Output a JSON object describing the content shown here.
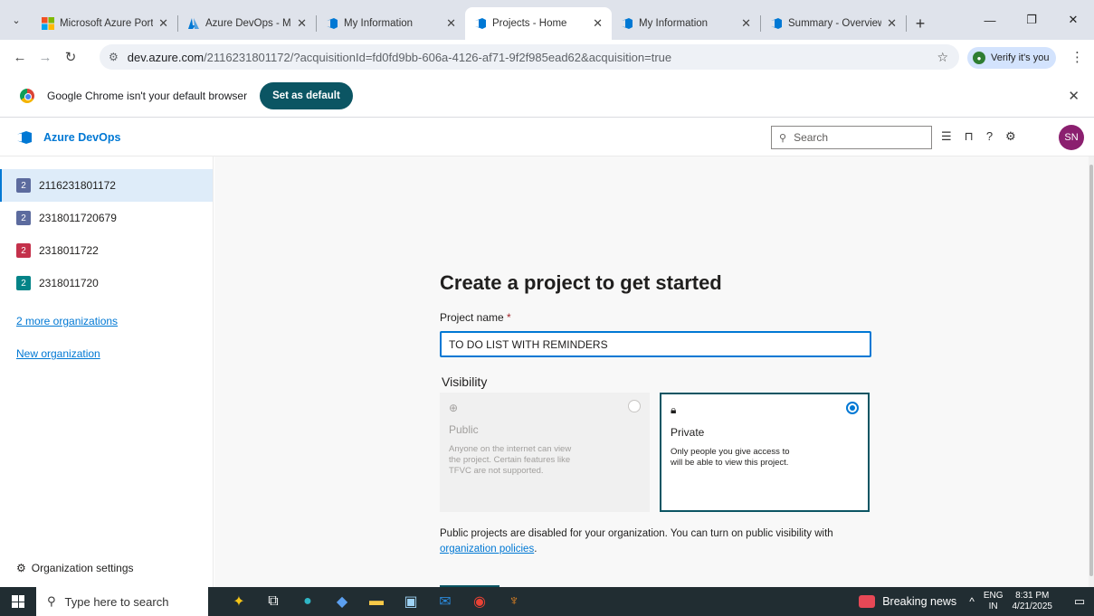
{
  "browser": {
    "tabs": [
      {
        "title": "Microsoft Azure Porta",
        "active": false,
        "favicon_color": "#f25022"
      },
      {
        "title": "Azure DevOps - Micr",
        "active": false,
        "favicon_color": "#0078d4"
      },
      {
        "title": "My Information",
        "active": false,
        "favicon_color": "#0078d4"
      },
      {
        "title": "Projects - Home",
        "active": true,
        "favicon_color": "#0078d4"
      },
      {
        "title": "My Information",
        "active": false,
        "favicon_color": "#0078d4"
      },
      {
        "title": "Summary - Overview",
        "active": false,
        "favicon_color": "#0078d4"
      }
    ],
    "url_host": "dev.azure.com",
    "url_rest": "/2116231801172/?acquisitionId=fd0fd9bb-606a-4126-af71-9f2f985ead62&acquisition=true",
    "verify_label": "Verify it's you",
    "infobar_message": "Google Chrome isn't your default browser",
    "infobar_button": "Set as default"
  },
  "header": {
    "product_name": "Azure DevOps",
    "search_placeholder": "Search",
    "avatar_initials": "SN"
  },
  "sidebar": {
    "organizations": [
      {
        "name": "2116231801172",
        "badge": "2",
        "color": "#5c6b9e",
        "selected": true
      },
      {
        "name": "2318011720679",
        "badge": "2",
        "color": "#5c6b9e",
        "selected": false
      },
      {
        "name": "2318011722",
        "badge": "2",
        "color": "#c4314b",
        "selected": false
      },
      {
        "name": "2318011720",
        "badge": "2",
        "color": "#038387",
        "selected": false
      }
    ],
    "more_orgs_link": "2 more organizations",
    "new_org_link": "New organization",
    "org_settings_label": "Organization settings"
  },
  "main": {
    "heading": "Create a project to get started",
    "project_name_label": "Project name",
    "required_mark": "*",
    "project_name_value": "TO DO LIST WITH REMINDERS",
    "visibility_label": "Visibility",
    "public": {
      "title": "Public",
      "description": "Anyone on the internet can view the project. Certain features like TFVC are not supported."
    },
    "private": {
      "title": "Private",
      "description": "Only people you give access to will be able to view this project."
    },
    "note_text": "Public projects are disabled for your organization. You can turn on public visibility with",
    "note_link": "organization policies",
    "note_end": "."
  },
  "taskbar": {
    "search_placeholder": "Type here to search",
    "news_label": "Breaking news",
    "lang_top": "ENG",
    "lang_bottom": "IN",
    "time": "8:31 PM",
    "date": "4/21/2025"
  }
}
